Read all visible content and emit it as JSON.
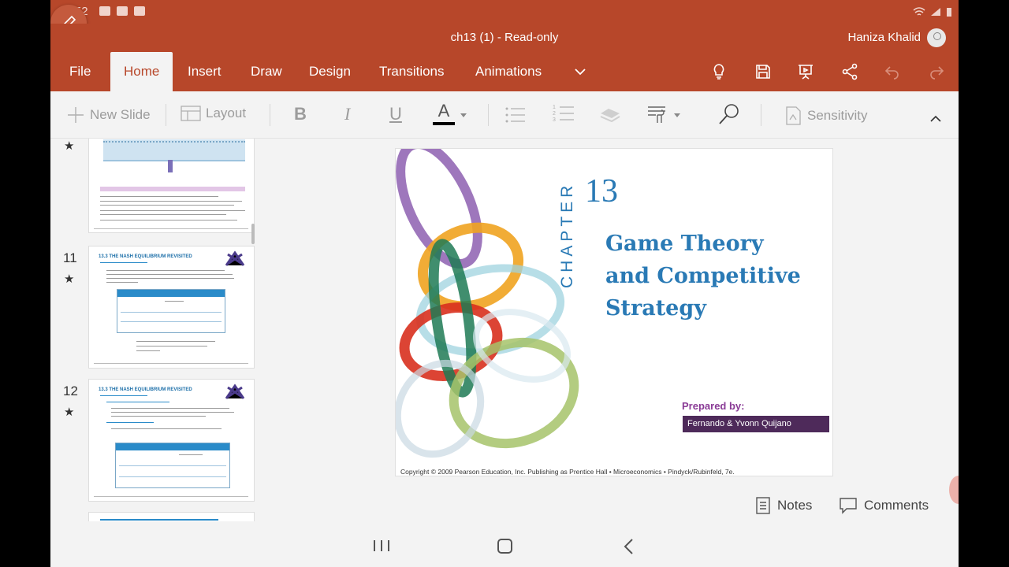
{
  "status": {
    "time": "08:52"
  },
  "window": {
    "title": "ch13 (1) - Read-only",
    "user": "Haniza Khalid"
  },
  "tabs": {
    "file": "File",
    "home": "Home",
    "insert": "Insert",
    "draw": "Draw",
    "design": "Design",
    "transitions": "Transitions",
    "animations": "Animations"
  },
  "toolbar": {
    "new_slide": "New Slide",
    "layout": "Layout",
    "bold": "B",
    "italic": "I",
    "underline": "U",
    "font_color": "A",
    "sensitivity": "Sensitivity"
  },
  "thumbnails": [
    {
      "number": "",
      "header": ""
    },
    {
      "number": "11",
      "header": "13.3  THE NASH EQUILIBRIUM REVISITED",
      "table": "TABLE 13.4  Maximin Strategy"
    },
    {
      "number": "12",
      "header": "13.3  THE NASH EQUILIBRIUM REVISITED",
      "table": "TABLE 13.5  Prisoners' Dilemma"
    }
  ],
  "slide": {
    "chapter_word": "CHAPTER",
    "chapter_number": "13",
    "title_line1": "Game Theory",
    "title_line2": "and Competitive",
    "title_line3": "Strategy",
    "prepared_label": "Prepared by:",
    "prepared_names": "Fernando & Yvonn Quijano",
    "copyright": "Copyright © 2009 Pearson Education, Inc. Publishing as Prentice Hall  •  Microeconomics  •  Pindyck/Rubinfeld, 7e."
  },
  "bottom": {
    "notes": "Notes",
    "comments": "Comments"
  },
  "colors": {
    "accent": "#b7472a",
    "title_blue": "#2a7ab5",
    "purple": "#4e2a5a"
  }
}
